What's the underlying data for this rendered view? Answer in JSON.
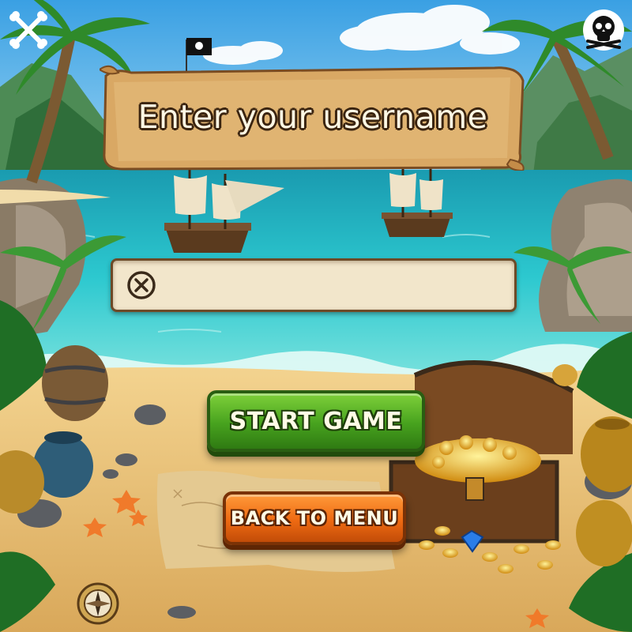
{
  "title": "Enter your username",
  "username_input": {
    "value": "",
    "placeholder": ""
  },
  "buttons": {
    "start": "START GAME",
    "back": "BACK TO MENU"
  },
  "icons": {
    "top_left": "crossed-bones-icon",
    "top_right": "skull-icon",
    "clear": "clear-x-icon",
    "bottom_compass": "compass-icon"
  },
  "colors": {
    "sky": "#6ec3ef",
    "sea": "#27c4cc",
    "sand": "#ebc47a",
    "start_button": "#47a21e",
    "back_button": "#ee6a12",
    "parchment": "#d9a864"
  }
}
